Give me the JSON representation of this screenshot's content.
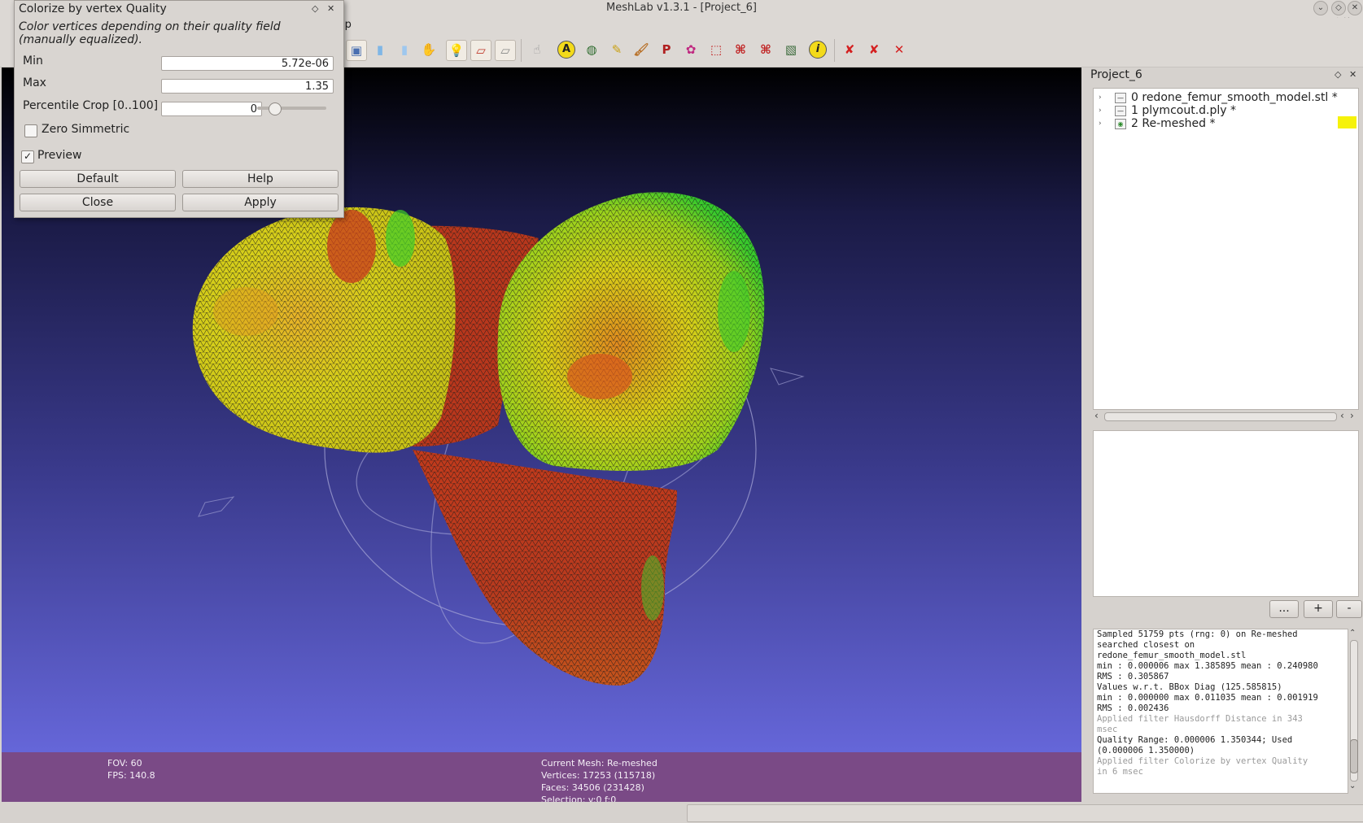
{
  "window": {
    "title": "MeshLab v1.3.1 - [Project_6]",
    "menu_tail": "lp"
  },
  "dialog": {
    "title": "Colorize by vertex Quality",
    "description": "Color vertices depending on their quality field (manually equalized).",
    "fields": {
      "min_label": "Min",
      "min_value": "5.72e-06",
      "max_label": "Max",
      "max_value": "1.35",
      "percentile_label": "Percentile Crop [0..100]",
      "percentile_value": "0",
      "percentile_slider": 0.0
    },
    "zero_symmetric_label": "Zero Simmetric",
    "zero_symmetric_checked": false,
    "preview_label": "Preview",
    "preview_checked": true,
    "buttons": {
      "default": "Default",
      "help": "Help",
      "close": "Close",
      "apply": "Apply"
    }
  },
  "viewport": {
    "fov": "FOV: 60",
    "fps": "FPS:   140.8",
    "current_mesh": "Current Mesh: Re-meshed",
    "vertices": "Vertices: 17253 (115718)",
    "faces": "Faces: 34506 (231428)",
    "selection": "Selection: v:0 f:0"
  },
  "panel": {
    "title": "Project_6",
    "layers": [
      {
        "index": "0",
        "name": "redone_femur_smooth_model.stl *"
      },
      {
        "index": "1",
        "name": "plymcout.d.ply *"
      },
      {
        "index": "2",
        "name": "Re-meshed *"
      }
    ],
    "buttons": {
      "more": "...",
      "plus": "+",
      "minus": "-"
    }
  },
  "log": [
    {
      "text": "Sampled 51759 pts (rng: 0) on Re-meshed",
      "grey": false
    },
    {
      "text": "searched closest on",
      "grey": false
    },
    {
      "text": "redone_femur_smooth_model.stl",
      "grey": false
    },
    {
      "text": "min : 0.000006 max 1.385895 mean : 0.240980",
      "grey": false
    },
    {
      "text": "RMS : 0.305867",
      "grey": false
    },
    {
      "text": "Values w.r.t. BBox Diag (125.585815)",
      "grey": false
    },
    {
      "text": "min : 0.000000 max 0.011035 mean : 0.001919",
      "grey": false
    },
    {
      "text": "RMS : 0.002436",
      "grey": false
    },
    {
      "text": "Applied filter Hausdorff Distance in 343",
      "grey": true
    },
    {
      "text": "msec",
      "grey": true
    },
    {
      "text": "Quality Range: 0.000006 1.350344; Used",
      "grey": false
    },
    {
      "text": "(0.000006 1.350000)",
      "grey": false
    },
    {
      "text": "Applied filter Colorize by vertex Quality",
      "grey": true
    },
    {
      "text": "in 6 msec",
      "grey": true
    }
  ],
  "colors": {
    "infobar": "#7a4a86",
    "mesh_yellow": "#d8d416",
    "mesh_red": "#c8381c",
    "mesh_green": "#3fcf2a",
    "layer_highlight": "#f6f20a"
  }
}
